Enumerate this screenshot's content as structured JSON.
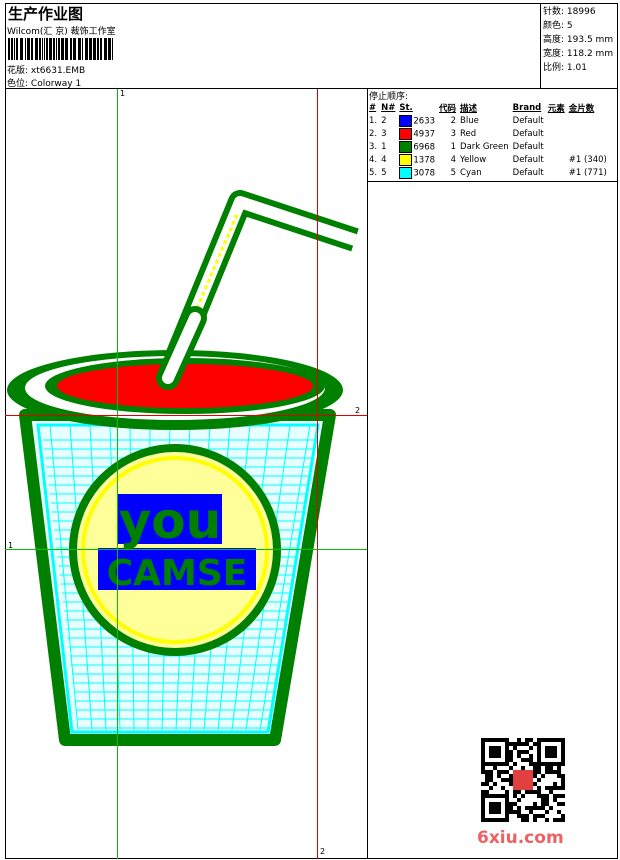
{
  "header": {
    "title": "生产作业图",
    "company": "Wilcom(汇 京) 裁饰工作室",
    "design_label": "花版:",
    "design_value": "xt6631.EMB",
    "colorway_label": "色位:",
    "colorway_value": "Colorway 1"
  },
  "info": [
    {
      "label": "针数:",
      "value": "18996"
    },
    {
      "label": "颜色:",
      "value": "5"
    },
    {
      "label": "高度:",
      "value": "193.5 mm"
    },
    {
      "label": "宽度:",
      "value": "118.2 mm"
    },
    {
      "label": "比例:",
      "value": "1.01"
    }
  ],
  "stop_sequence": {
    "title": "停止顺序:",
    "columns": [
      "#",
      "N#",
      "St.",
      "代码",
      "描述",
      "Brand",
      "元素",
      "金片数"
    ],
    "rows": [
      {
        "idx": "1.",
        "n": "2",
        "color": "#0000ff",
        "st": "2633",
        "code": "2",
        "desc": "Blue",
        "brand": "Default",
        "elem": "",
        "seq": ""
      },
      {
        "idx": "2.",
        "n": "3",
        "color": "#ff0000",
        "st": "4937",
        "code": "3",
        "desc": "Red",
        "brand": "Default",
        "elem": "",
        "seq": ""
      },
      {
        "idx": "3.",
        "n": "1",
        "color": "#008000",
        "st": "6968",
        "code": "1",
        "desc": "Dark Green",
        "brand": "Default",
        "elem": "",
        "seq": ""
      },
      {
        "idx": "4.",
        "n": "4",
        "color": "#ffff00",
        "st": "1378",
        "code": "4",
        "desc": "Yellow",
        "brand": "Default",
        "elem": "",
        "seq": "#1 (340)"
      },
      {
        "idx": "5.",
        "n": "5",
        "color": "#00ffff",
        "st": "3078",
        "code": "5",
        "desc": "Cyan",
        "brand": "Default",
        "elem": "",
        "seq": "#1 (771)"
      }
    ]
  },
  "guides": {
    "v1": "1",
    "v2": "2",
    "h1": "1",
    "h2": "2"
  },
  "design": {
    "logo_line1": "you",
    "logo_line2": "CAMSE"
  },
  "watermark": "6xiu.com"
}
